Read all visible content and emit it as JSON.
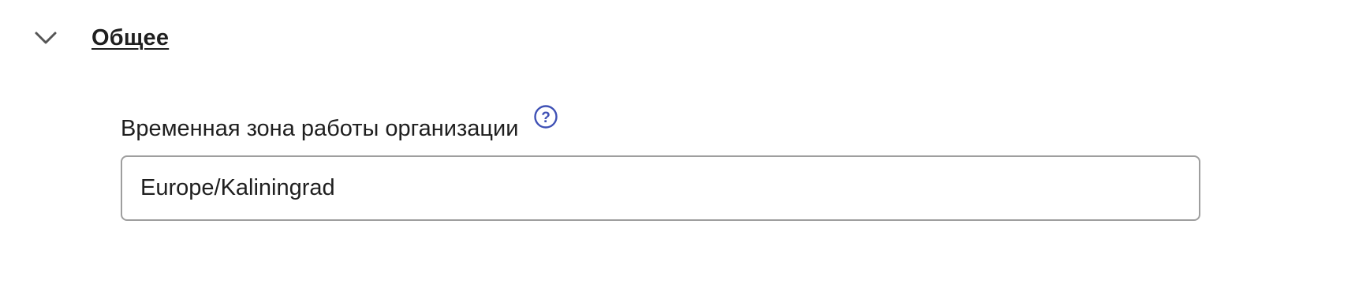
{
  "section": {
    "title": "Общее",
    "expanded": true,
    "toggle_icon": "chevron-down-icon"
  },
  "timezone_field": {
    "label": "Временная зона работы организации",
    "value": "Europe/Kaliningrad",
    "help_icon": "question-circle-icon"
  },
  "colors": {
    "text": "#1f1f1f",
    "accent": "#3f51b5",
    "border": "#9e9e9e",
    "chevron": "#555555"
  }
}
